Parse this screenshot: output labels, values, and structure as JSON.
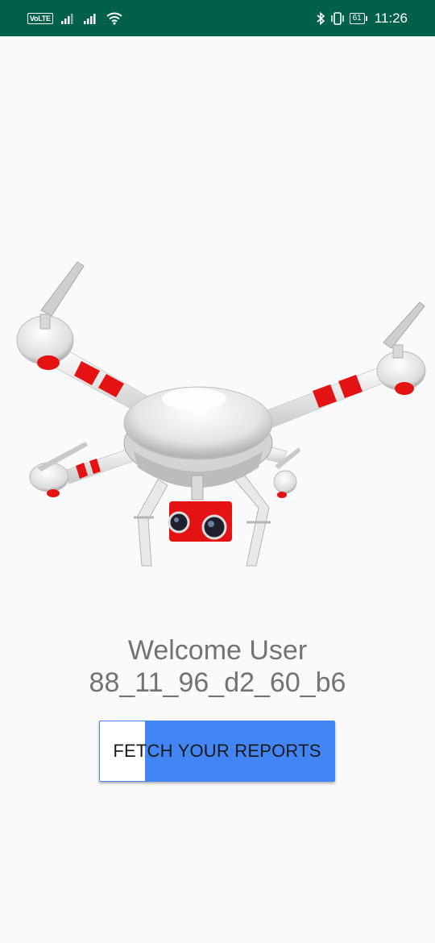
{
  "status_bar": {
    "network_badge": "VoLTE",
    "battery_level": "61",
    "time": "11:26"
  },
  "main": {
    "image_alt": "Drone illustration",
    "welcome_line1": "Welcome User",
    "welcome_line2": "88_11_96_d2_60_b6",
    "fetch_button_label": "FETCH YOUR REPORTS"
  },
  "colors": {
    "status_bar": "#00604a",
    "button": "#4285f4",
    "background": "#fafafa",
    "drone_accent": "#e41212"
  }
}
